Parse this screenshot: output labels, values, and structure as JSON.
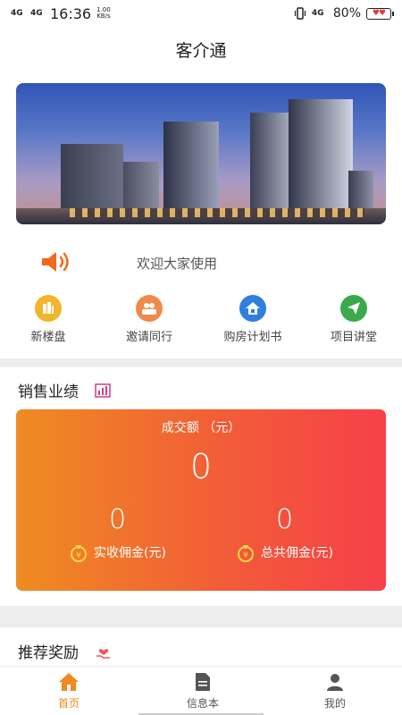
{
  "status_bar": {
    "signal_left_1": "4G",
    "signal_left_2": "4G",
    "time": "16:36",
    "speed_value": "1.00",
    "speed_unit": "KB/s",
    "network_right": "4G",
    "battery": "80%"
  },
  "header": {
    "title": "客介通"
  },
  "notice": {
    "text": "欢迎大家使用"
  },
  "quick_menu": [
    {
      "label": "新楼盘",
      "color": "#f2b62b",
      "icon": "building-icon"
    },
    {
      "label": "邀请同行",
      "color": "#f08a4b",
      "icon": "people-icon"
    },
    {
      "label": "购房计划书",
      "color": "#2f7fdc",
      "icon": "house-icon"
    },
    {
      "label": "项目讲堂",
      "color": "#3aa94b",
      "icon": "send-icon"
    }
  ],
  "sales": {
    "section_title": "销售业绩",
    "deal_label": "成交额 （元）",
    "deal_value": "0",
    "received": {
      "value": "0",
      "label": "实收佣金(元)"
    },
    "total": {
      "value": "0",
      "label": "总共佣金(元)"
    }
  },
  "reward": {
    "section_title": "推荐奖励"
  },
  "tabs": [
    {
      "label": "首页",
      "icon": "home-icon",
      "active": true
    },
    {
      "label": "信息本",
      "icon": "document-icon",
      "active": false
    },
    {
      "label": "我的",
      "icon": "user-icon",
      "active": false
    }
  ],
  "colors": {
    "accent": "#f08a1e",
    "card_gradient_start": "#ef8c22",
    "card_gradient_end": "#f6404a"
  }
}
